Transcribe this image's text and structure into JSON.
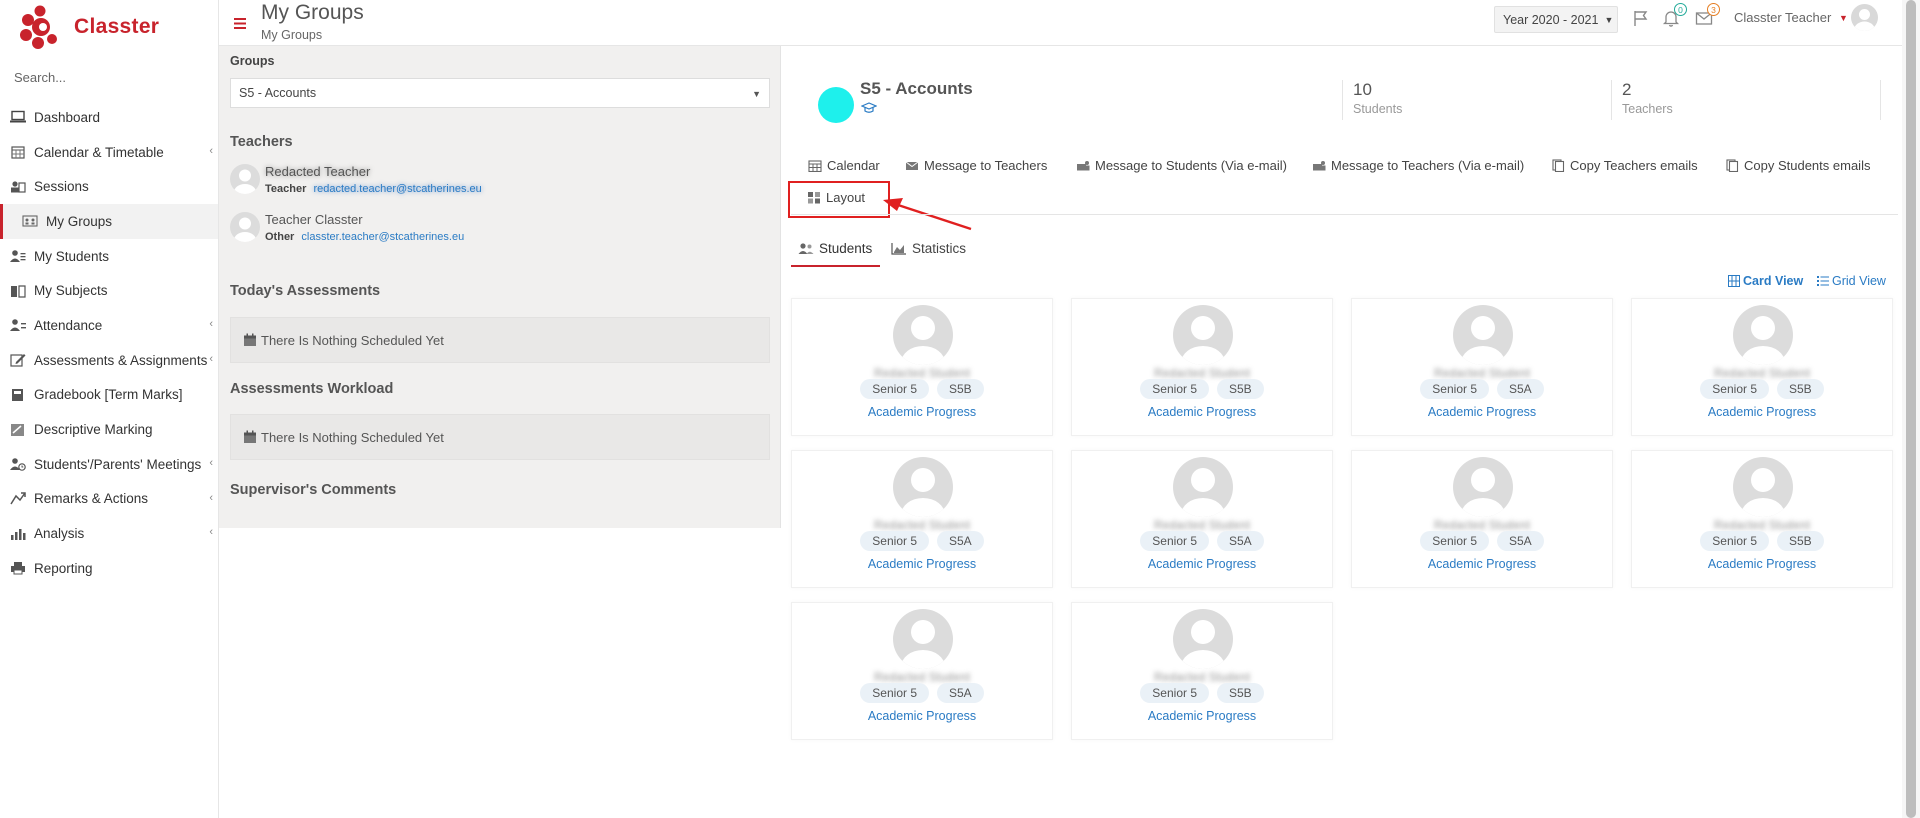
{
  "app": {
    "name": "Classter",
    "brand_color": "#c8232c"
  },
  "sidebar": {
    "search_placeholder": "Search...",
    "items": [
      {
        "label": "Dashboard",
        "icon": "laptop-icon",
        "chevron": false
      },
      {
        "label": "Calendar & Timetable",
        "icon": "calendar-icon",
        "chevron": true
      },
      {
        "label": "Sessions",
        "icon": "users-icon",
        "chevron": false
      },
      {
        "label": "My Groups",
        "icon": "group-icon",
        "chevron": false,
        "active": true
      },
      {
        "label": "My Students",
        "icon": "student-icon",
        "chevron": false
      },
      {
        "label": "My Subjects",
        "icon": "book-icon",
        "chevron": false
      },
      {
        "label": "Attendance",
        "icon": "attendance-icon",
        "chevron": true
      },
      {
        "label": "Assessments & Assignments",
        "icon": "edit-icon",
        "chevron": true
      },
      {
        "label": "Gradebook [Term Marks]",
        "icon": "gradebook-icon",
        "chevron": false
      },
      {
        "label": "Descriptive Marking",
        "icon": "marking-icon",
        "chevron": false
      },
      {
        "label": "Students'/Parents' Meetings",
        "icon": "meeting-icon",
        "chevron": true
      },
      {
        "label": "Remarks & Actions",
        "icon": "remarks-icon",
        "chevron": true
      },
      {
        "label": "Analysis",
        "icon": "analysis-icon",
        "chevron": true
      },
      {
        "label": "Reporting",
        "icon": "printer-icon",
        "chevron": false
      }
    ]
  },
  "header": {
    "title": "My Groups",
    "subtitle": "My Groups",
    "year": "Year 2020 - 2021",
    "notifications": "0",
    "messages": "3",
    "user": "Classter Teacher"
  },
  "left": {
    "groups_label": "Groups",
    "group_selected": "S5 - Accounts",
    "teachers_title": "Teachers",
    "teachers": [
      {
        "name": "Redacted Teacher",
        "role": "Teacher",
        "email": "redacted.teacher@stcatherines.eu",
        "blurred": true
      },
      {
        "name": "Teacher Classter",
        "role": "Other",
        "email": "classter.teacher@stcatherines.eu",
        "blurred": false
      }
    ],
    "todays_title": "Today's Assessments",
    "todays_empty": "There Is Nothing Scheduled Yet",
    "workload_title": "Assessments Workload",
    "workload_empty": "There Is Nothing Scheduled Yet",
    "supervisor_title": "Supervisor's Comments"
  },
  "group": {
    "name": "S5 - Accounts",
    "circle_color": "#1ef0ec",
    "students_count": "10",
    "students_label": "Students",
    "teachers_count": "2",
    "teachers_label": "Teachers"
  },
  "actions": {
    "calendar": "Calendar",
    "msg_teachers": "Message to Teachers",
    "msg_students_email": "Message to Students (Via e-mail)",
    "msg_teachers_email": "Message to Teachers (Via e-mail)",
    "copy_teachers": "Copy Teachers emails",
    "copy_students": "Copy Students emails",
    "layout": "Layout"
  },
  "tabs": {
    "students": "Students",
    "statistics": "Statistics"
  },
  "views": {
    "card": "Card View",
    "grid": "Grid View"
  },
  "students": [
    {
      "name": "Redacted Student",
      "year": "Senior 5",
      "class": "S5B",
      "link": "Academic Progress"
    },
    {
      "name": "Redacted Student",
      "year": "Senior 5",
      "class": "S5B",
      "link": "Academic Progress"
    },
    {
      "name": "Redacted Student",
      "year": "Senior 5",
      "class": "S5A",
      "link": "Academic Progress"
    },
    {
      "name": "Redacted Student",
      "year": "Senior 5",
      "class": "S5B",
      "link": "Academic Progress"
    },
    {
      "name": "Redacted Student",
      "year": "Senior 5",
      "class": "S5A",
      "link": "Academic Progress"
    },
    {
      "name": "Redacted Student",
      "year": "Senior 5",
      "class": "S5A",
      "link": "Academic Progress"
    },
    {
      "name": "Redacted Student",
      "year": "Senior 5",
      "class": "S5A",
      "link": "Academic Progress"
    },
    {
      "name": "Redacted Student",
      "year": "Senior 5",
      "class": "S5B",
      "link": "Academic Progress"
    },
    {
      "name": "Redacted Student",
      "year": "Senior 5",
      "class": "S5A",
      "link": "Academic Progress"
    },
    {
      "name": "Redacted Student",
      "year": "Senior 5",
      "class": "S5B",
      "link": "Academic Progress"
    }
  ]
}
